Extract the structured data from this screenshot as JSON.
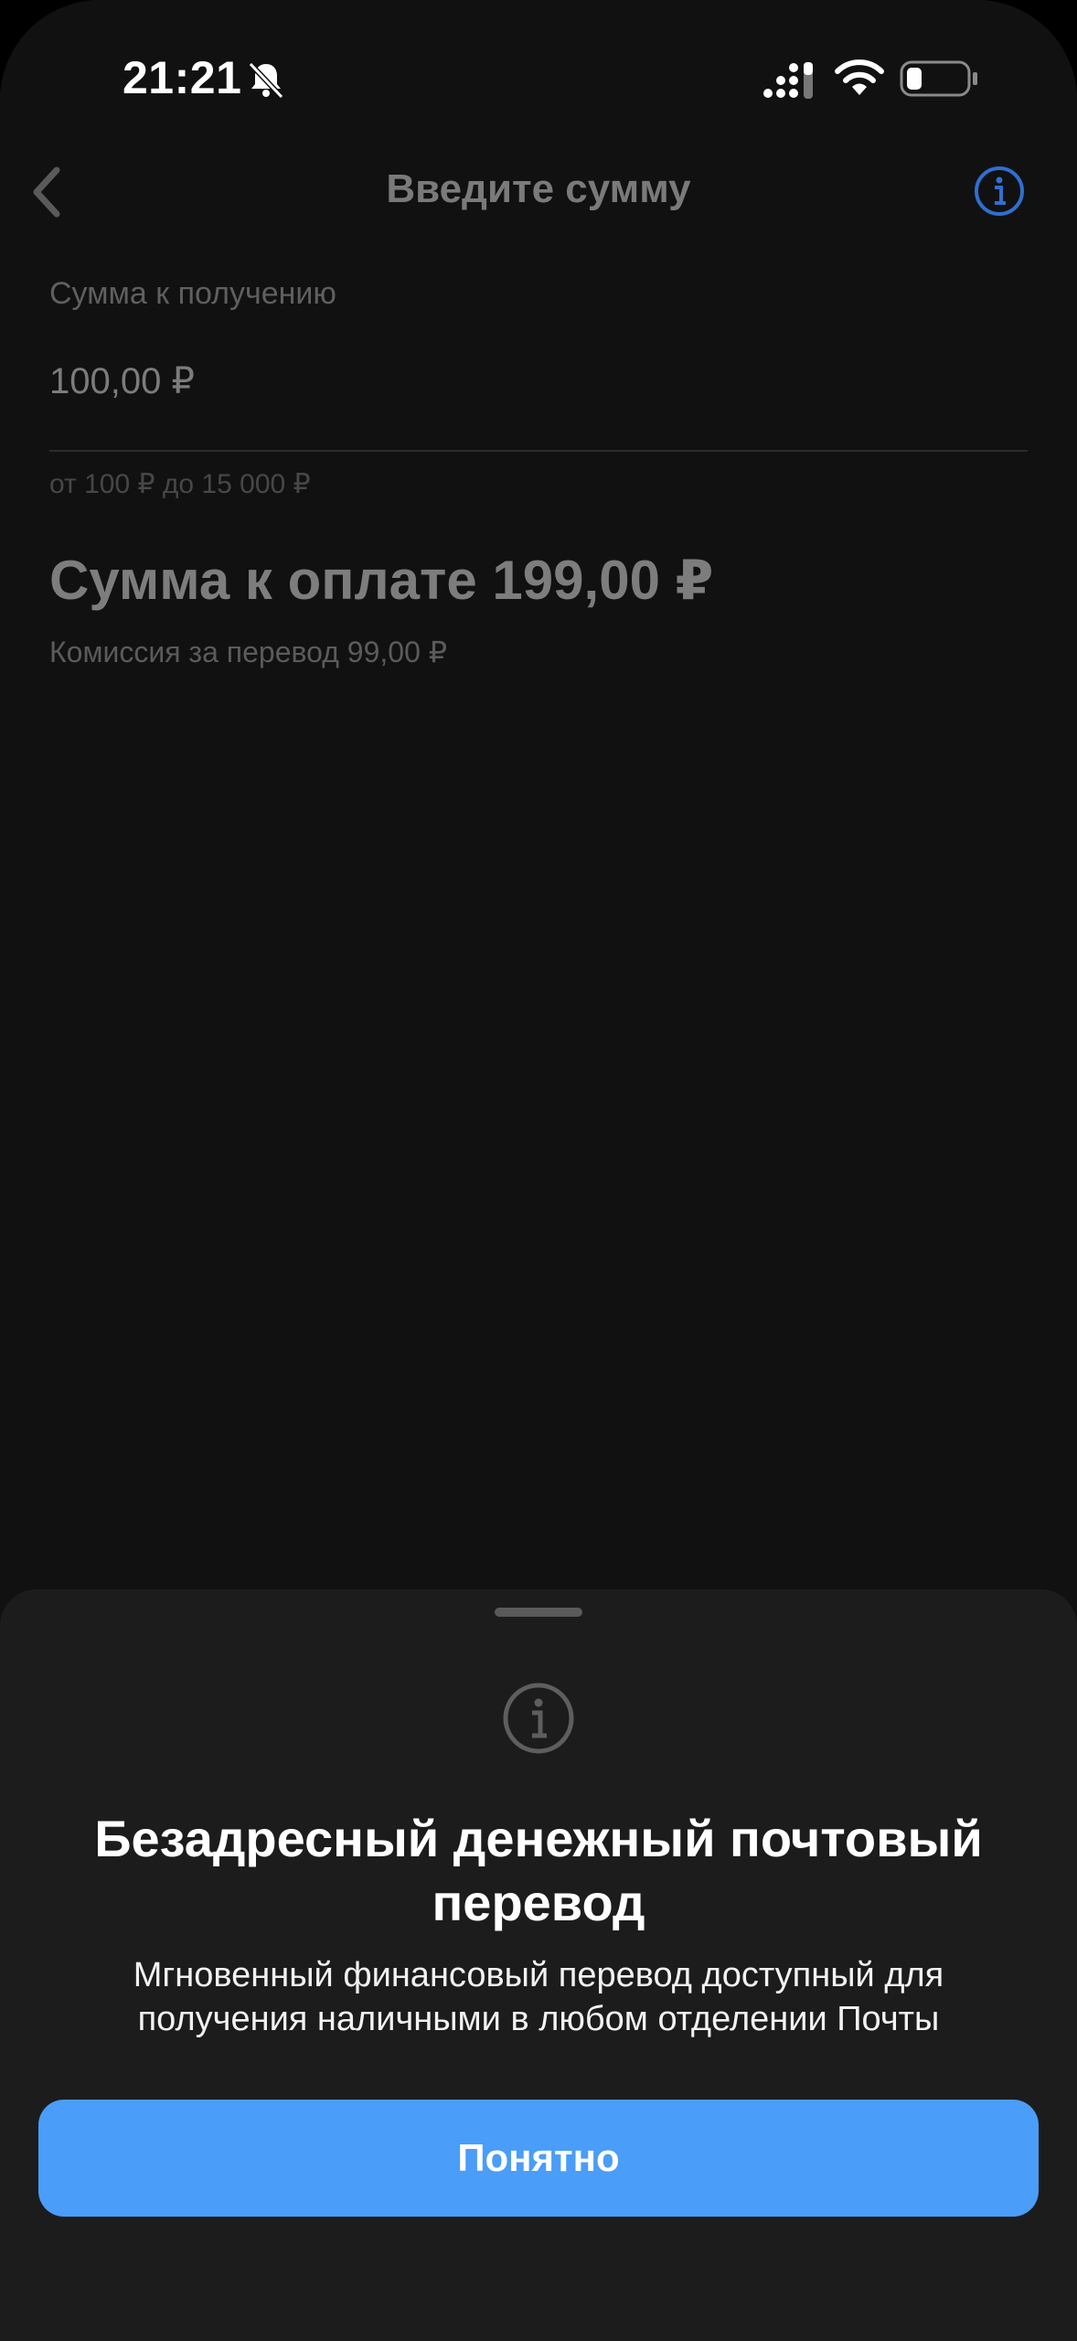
{
  "status_bar": {
    "time": "21:21",
    "icons": [
      "bell-slash-icon",
      "signal-icon",
      "wifi-icon",
      "battery-icon"
    ]
  },
  "nav": {
    "title": "Введите сумму",
    "back_icon": "chevron-left-icon",
    "info_icon": "info-circle-icon",
    "info_color": "#2f6fd0"
  },
  "form": {
    "label": "Сумма к получению",
    "value": "100,00 ₽",
    "hint": "от 100 ₽ до 15 000 ₽"
  },
  "summary": {
    "total": "Сумма к оплате 199,00 ₽",
    "commission": "Комиссия за перевод 99,00 ₽"
  },
  "sheet": {
    "icon": "info-circle-icon",
    "title": "Безадресный денежный почтовый перевод",
    "description": "Мгновенный финансовый перевод доступный для получения наличными в любом отделении Почты",
    "button_label": "Понятно",
    "button_color": "#4a9df8"
  }
}
